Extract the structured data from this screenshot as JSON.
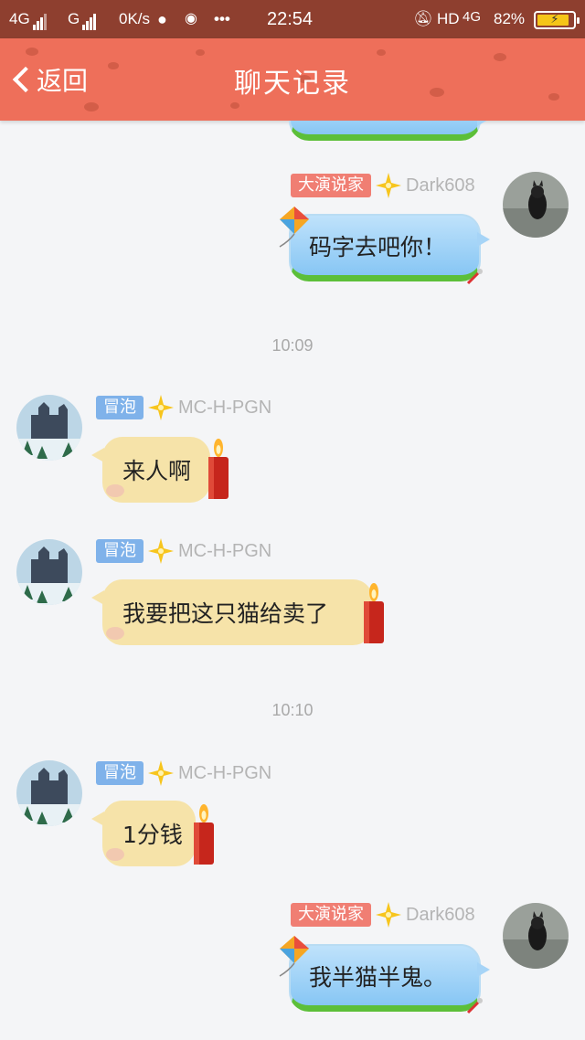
{
  "status_bar": {
    "net1": "4G",
    "net2": "G",
    "speed": "0K/s",
    "hd": "HD",
    "net3": "4G",
    "time": "22:54",
    "battery": "82%"
  },
  "nav": {
    "back_label": "返回",
    "title": "聊天记录"
  },
  "messages": [
    {
      "side": "right",
      "badge": "大演说家",
      "name": "Dark608",
      "text": "码字去吧你！"
    },
    {
      "time": "10:09"
    },
    {
      "side": "left",
      "badge": "冒泡",
      "name": "MC-H-PGN",
      "text": "来人啊"
    },
    {
      "side": "left",
      "badge": "冒泡",
      "name": "MC-H-PGN",
      "text": "我要把这只猫给卖了"
    },
    {
      "time": "10:10"
    },
    {
      "side": "left",
      "badge": "冒泡",
      "name": "MC-H-PGN",
      "text": "1分钱"
    },
    {
      "side": "right",
      "badge": "大演说家",
      "name": "Dark608",
      "text": "我半猫半鬼。"
    }
  ],
  "colors": {
    "nav_bg": "#ee6f5a",
    "status_bg": "#8e3f2f",
    "self_bubble": "#9ccff6",
    "other_bubble": "#f6e3a9",
    "badge_red": "#f07e73",
    "badge_blue": "#7fb2ea"
  }
}
